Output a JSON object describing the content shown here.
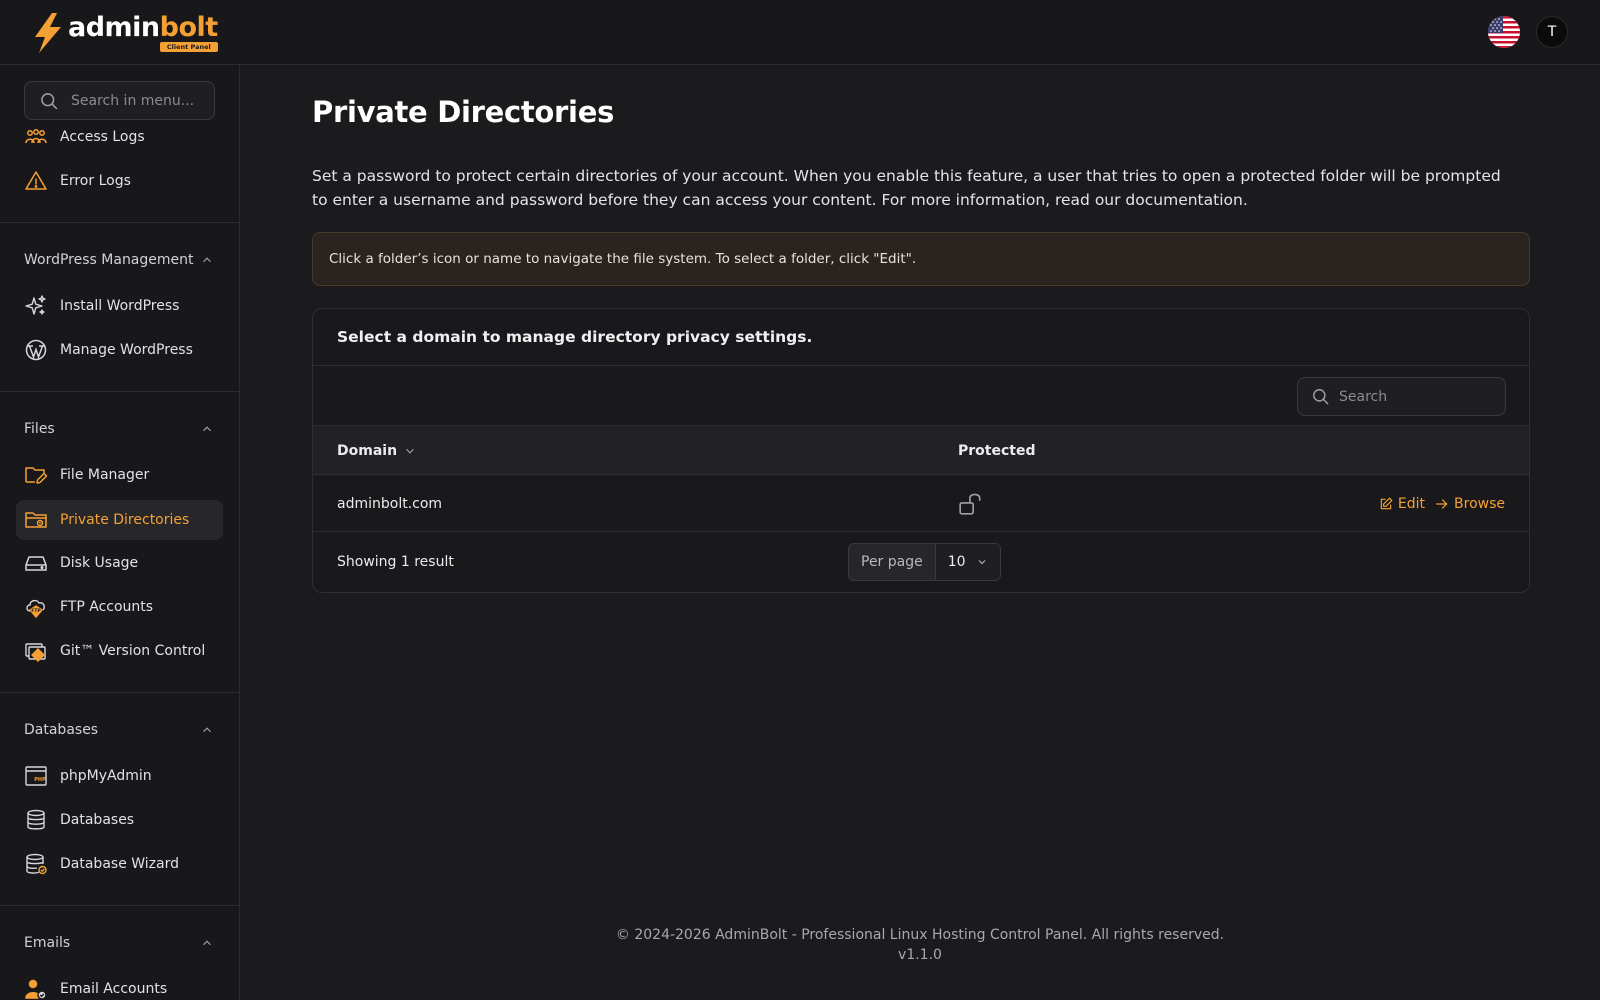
{
  "brand": {
    "name_part1": "admin",
    "name_part2": "bolt",
    "badge": "Client Panel",
    "accent_color": "#f5a035"
  },
  "header": {
    "language_flag": "us-flag-icon",
    "avatar_initial": "T"
  },
  "sidebar": {
    "search_placeholder": "Search in menu...",
    "items_top": [
      {
        "label": "Access Logs",
        "icon": "access-logs-icon"
      },
      {
        "label": "Error Logs",
        "icon": "warning-icon"
      }
    ],
    "sections": [
      {
        "title": "WordPress Management",
        "items": [
          {
            "label": "Install WordPress",
            "icon": "sparkles-icon"
          },
          {
            "label": "Manage WordPress",
            "icon": "wordpress-icon"
          }
        ]
      },
      {
        "title": "Files",
        "items": [
          {
            "label": "File Manager",
            "icon": "folder-edit-icon"
          },
          {
            "label": "Private Directories",
            "icon": "folder-lock-icon",
            "active": true
          },
          {
            "label": "Disk Usage",
            "icon": "hard-drive-icon"
          },
          {
            "label": "FTP Accounts",
            "icon": "ftp-cloud-icon"
          },
          {
            "label": "Git™ Version Control",
            "icon": "git-icon"
          }
        ]
      },
      {
        "title": "Databases",
        "items": [
          {
            "label": "phpMyAdmin",
            "icon": "phpmyadmin-icon"
          },
          {
            "label": "Databases",
            "icon": "database-icon"
          },
          {
            "label": "Database Wizard",
            "icon": "database-wizard-icon"
          }
        ]
      },
      {
        "title": "Emails",
        "items": [
          {
            "label": "Email Accounts",
            "icon": "email-accounts-icon"
          }
        ]
      }
    ]
  },
  "main": {
    "title": "Private Directories",
    "description": "Set a password to protect certain directories of your account. When you enable this feature, a user that tries to open a protected folder will be prompted to enter a username and password before they can access your content. For more information, read our documentation.",
    "notice": "Click a folder’s icon or name to navigate the file system. To select a folder, click \"Edit\".",
    "card": {
      "heading": "Select a domain to manage directory privacy settings.",
      "search_placeholder": "Search",
      "columns": {
        "domain": "Domain",
        "protected": "Protected"
      },
      "rows": [
        {
          "domain": "adminbolt.com",
          "protected_icon": "lock-open-icon",
          "edit_label": "Edit",
          "browse_label": "Browse"
        }
      ],
      "showing": "Showing 1 result",
      "per_page_label": "Per page",
      "per_page_value": "10"
    }
  },
  "footer": {
    "copyright": "© 2024-2026 AdminBolt - Professional Linux Hosting Control Panel. All rights reserved.",
    "version": "v1.1.0"
  }
}
